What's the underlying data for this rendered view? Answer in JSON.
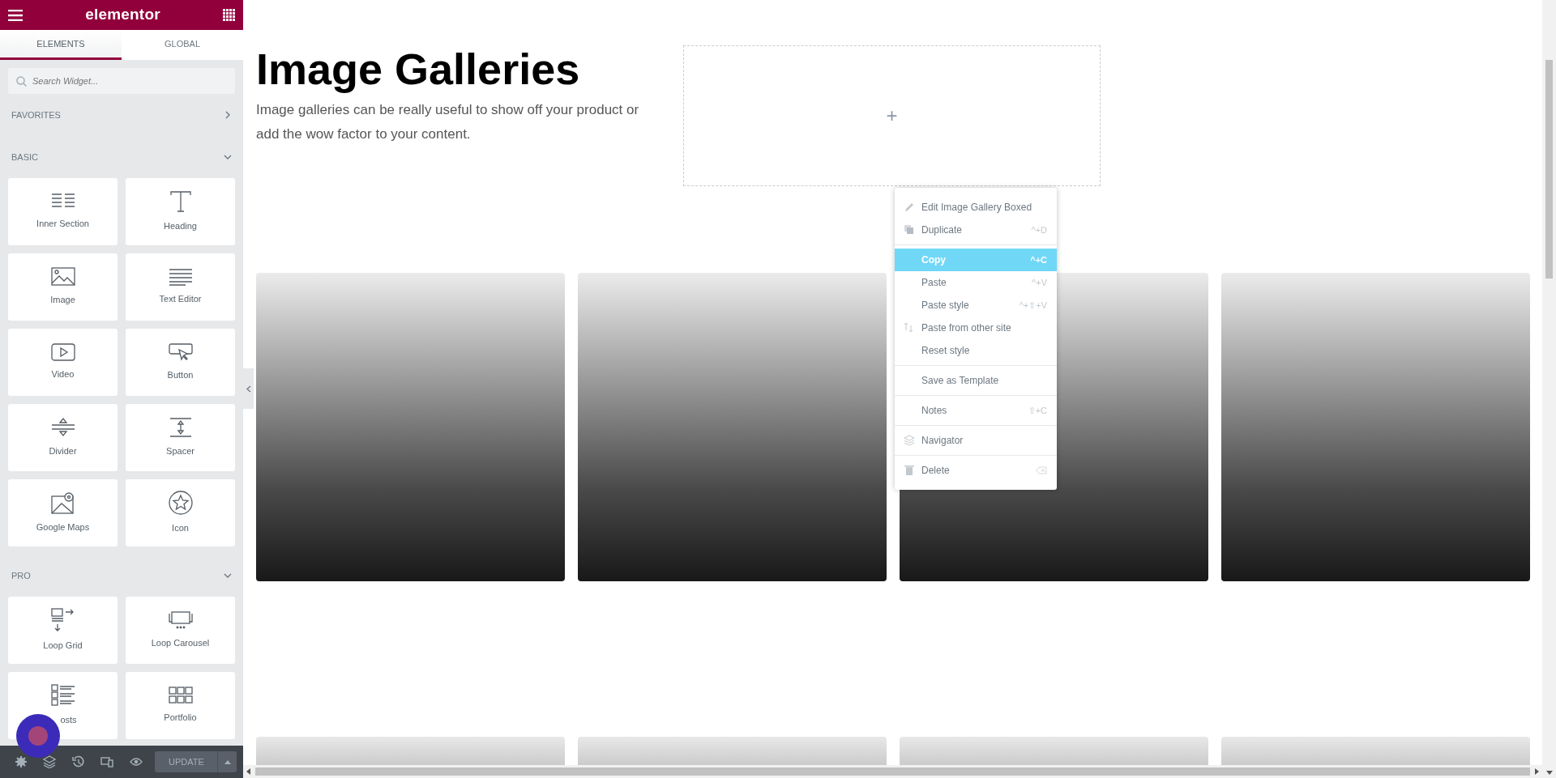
{
  "sidebar": {
    "logo": "elementor",
    "tabs": [
      {
        "label": "ELEMENTS",
        "selected": true
      },
      {
        "label": "GLOBAL",
        "selected": false
      }
    ],
    "search": {
      "placeholder": "Search Widget..."
    },
    "sections": [
      {
        "title": "FAVORITES",
        "expanded": false
      },
      {
        "title": "BASIC",
        "expanded": true,
        "widgets": [
          "Inner Section",
          "Heading",
          "Image",
          "Text Editor",
          "Video",
          "Button",
          "Divider",
          "Spacer",
          "Google Maps",
          "Icon"
        ]
      },
      {
        "title": "PRO",
        "expanded": true,
        "widgets": [
          "Loop Grid",
          "Loop Carousel",
          "osts",
          "Portfolio"
        ]
      }
    ],
    "footer": {
      "update_button": "UPDATE"
    }
  },
  "page": {
    "heading": "Image Galleries",
    "intro": "Image galleries can be really useful to show off your product or add the wow factor to your content.",
    "add_button": "+"
  },
  "context_menu": [
    [
      {
        "label": "Edit Image Gallery Boxed",
        "selected": false
      },
      {
        "label": "Duplicate",
        "shortcut": "^+D",
        "selected": false
      }
    ],
    [
      {
        "label": "Copy",
        "shortcut": "^+C",
        "selected": true
      },
      {
        "label": "Paste",
        "shortcut": "^+V",
        "selected": false
      },
      {
        "label": "Paste style",
        "shortcut": "^+⇧+V",
        "selected": false
      },
      {
        "label": "Paste from other site",
        "selected": false
      },
      {
        "label": "Reset style",
        "selected": false
      }
    ],
    [
      {
        "label": "Save as Template",
        "selected": false
      }
    ],
    [
      {
        "label": "Notes",
        "shortcut": "⇧+C",
        "selected": false
      }
    ],
    [
      {
        "label": "Navigator",
        "selected": false
      }
    ],
    [
      {
        "label": "Delete",
        "selected": false
      }
    ]
  ]
}
